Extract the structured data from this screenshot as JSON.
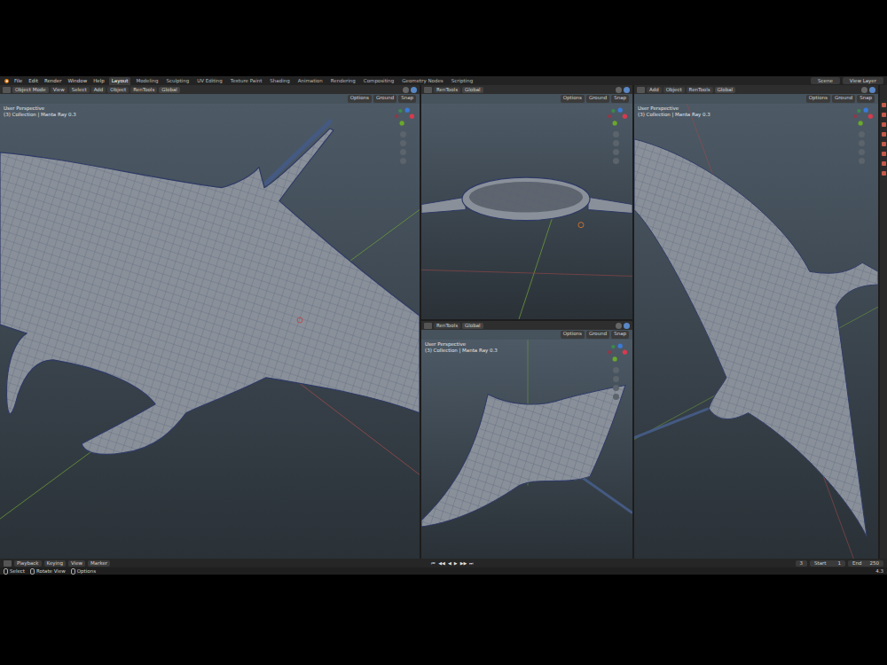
{
  "menu": [
    "File",
    "Edit",
    "Render",
    "Window",
    "Help"
  ],
  "workspaces": [
    {
      "label": "Layout",
      "selected": true
    },
    {
      "label": "Modeling",
      "selected": false
    },
    {
      "label": "Sculpting",
      "selected": false
    },
    {
      "label": "UV Editing",
      "selected": false
    },
    {
      "label": "Texture Paint",
      "selected": false
    },
    {
      "label": "Shading",
      "selected": false
    },
    {
      "label": "Animation",
      "selected": false
    },
    {
      "label": "Rendering",
      "selected": false
    },
    {
      "label": "Compositing",
      "selected": false
    },
    {
      "label": "Geometry Nodes",
      "selected": false
    },
    {
      "label": "Scripting",
      "selected": false
    }
  ],
  "scene": "Scene",
  "view_layer": "View Layer",
  "viewports": [
    {
      "kind": "perspective",
      "mode": "Object Mode",
      "menus": [
        "View",
        "Select",
        "Add",
        "Object",
        "RenTools"
      ],
      "orientation": "Global",
      "tools": [
        "Options",
        "Ground",
        "Snap"
      ],
      "overlay": [
        "User Perspective",
        "(3) Collection | Manta Ray 0.3"
      ]
    },
    {
      "kind": "front",
      "menus": [
        "RenTools"
      ],
      "orientation": "Global",
      "tools": [
        "Options",
        "Ground",
        "Snap"
      ],
      "overlay": []
    },
    {
      "kind": "top",
      "menus": [
        "RenTools"
      ],
      "orientation": "Global",
      "tools": [
        "Options",
        "Ground",
        "Snap"
      ],
      "overlay": [
        "User Perspective",
        "(3) Collection | Manta Ray 0.3"
      ]
    },
    {
      "kind": "side",
      "menus": [
        "Add",
        "Object",
        "RenTools"
      ],
      "orientation": "Global",
      "tools": [
        "Options",
        "Ground",
        "Snap"
      ],
      "overlay": [
        "User Perspective",
        "(3) Collection | Manta Ray 0.3"
      ]
    }
  ],
  "timeline": {
    "menus": [
      "Playback",
      "Keying",
      "View",
      "Marker"
    ],
    "controls": [
      "⏮",
      "◀◀",
      "◀",
      "▶",
      "▶▶",
      "⏭"
    ],
    "frame": "3",
    "start_label": "Start",
    "start": "1",
    "end_label": "End",
    "end": "250"
  },
  "status": {
    "items": [
      "Select",
      "Rotate View",
      "Options"
    ],
    "version": "4.3"
  }
}
